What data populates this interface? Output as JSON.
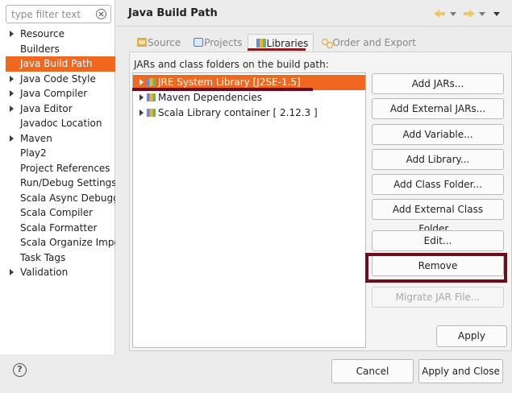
{
  "filter": {
    "placeholder": "type filter text"
  },
  "sidebar": {
    "items": [
      {
        "label": "Resource",
        "expandable": true
      },
      {
        "label": "Builders",
        "expandable": false
      },
      {
        "label": "Java Build Path",
        "expandable": false,
        "selected": true
      },
      {
        "label": "Java Code Style",
        "expandable": true
      },
      {
        "label": "Java Compiler",
        "expandable": true
      },
      {
        "label": "Java Editor",
        "expandable": true
      },
      {
        "label": "Javadoc Location",
        "expandable": false
      },
      {
        "label": "Maven",
        "expandable": true
      },
      {
        "label": "Play2",
        "expandable": false
      },
      {
        "label": "Project References",
        "expandable": false
      },
      {
        "label": "Run/Debug Settings",
        "expandable": false
      },
      {
        "label": "Scala Async Debugger",
        "expandable": false
      },
      {
        "label": "Scala Compiler",
        "expandable": false
      },
      {
        "label": "Scala Formatter",
        "expandable": false
      },
      {
        "label": "Scala Organize Imports",
        "expandable": false
      },
      {
        "label": "Task Tags",
        "expandable": false
      },
      {
        "label": "Validation",
        "expandable": true
      }
    ]
  },
  "header": {
    "title": "Java Build Path"
  },
  "tabs": [
    {
      "label": "Source",
      "icon": "source-folder-icon"
    },
    {
      "label": "Projects",
      "icon": "projects-icon"
    },
    {
      "label": "Libraries",
      "icon": "libraries-icon",
      "active": true
    },
    {
      "label": "Order and Export",
      "icon": "order-export-icon"
    }
  ],
  "libraries": {
    "label": "JARs and class folders on the build path:",
    "items": [
      {
        "label": "JRE System Library [J2SE-1.5]",
        "selected": true
      },
      {
        "label": "Maven Dependencies"
      },
      {
        "label": "Scala Library container [ 2.12.3 ]"
      }
    ]
  },
  "buttons": {
    "add_jars": "Add JARs...",
    "add_external_jars": "Add External JARs...",
    "add_variable": "Add Variable...",
    "add_library": "Add Library...",
    "add_class_folder": "Add Class Folder...",
    "add_external_class_folder": "Add External Class Folder...",
    "edit": "Edit...",
    "remove": "Remove",
    "migrate_jar": "Migrate JAR File..."
  },
  "footer": {
    "apply": "Apply",
    "cancel": "Cancel",
    "apply_and_close": "Apply and Close",
    "help": "?"
  },
  "colors": {
    "selection": "#f0671f",
    "annotation": "#6b0f1f"
  }
}
